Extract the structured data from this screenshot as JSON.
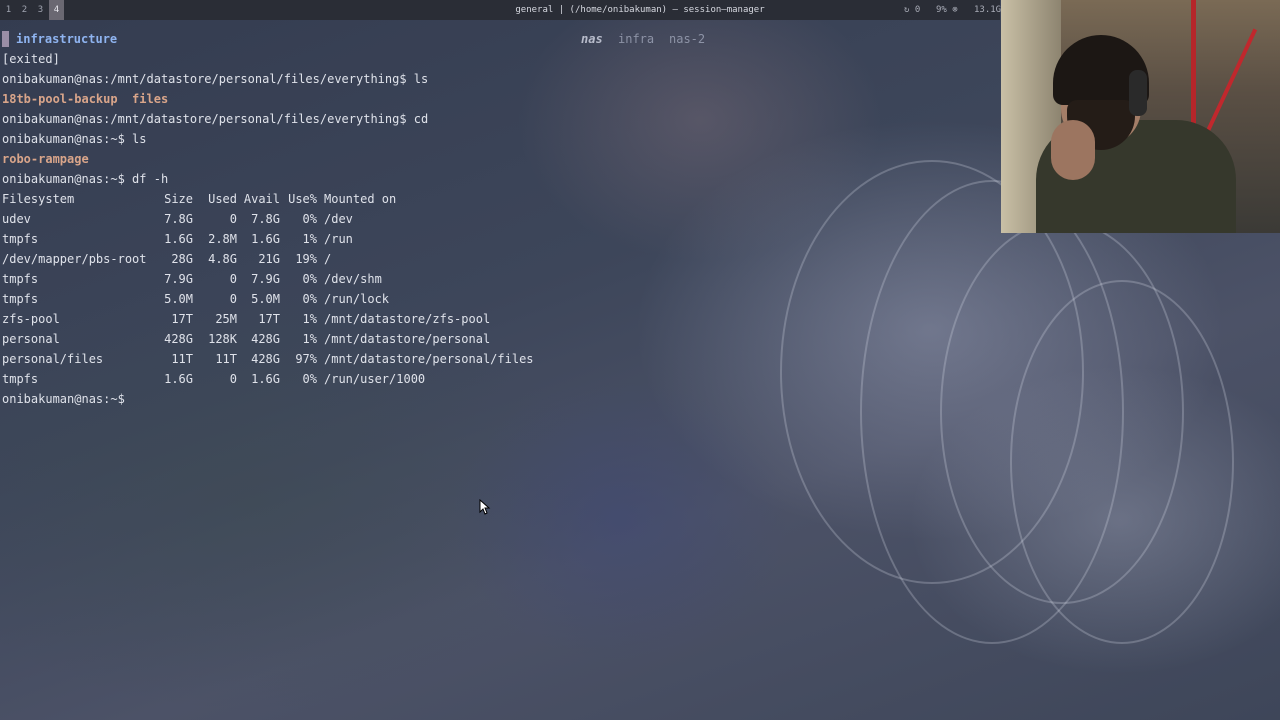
{
  "topbar": {
    "workspaces": [
      "1",
      "2",
      "3",
      "4"
    ],
    "active_workspace": "4",
    "window_title": "general | (/home/onibakuman) – session–manager",
    "stats": [
      "↻ 0",
      "9% ⊗",
      "13.1G"
    ]
  },
  "terminal": {
    "tab_name": "infrastructure",
    "sessions": [
      "nas",
      "infra",
      "nas-2"
    ],
    "current_session": "nas",
    "lines": [
      {
        "text": "[exited]",
        "type": "text"
      },
      {
        "text": "onibakuman@nas:/mnt/datastore/personal/files/everything$ ls",
        "type": "text"
      },
      {
        "dirs": [
          "18tb-pool-backup",
          "files"
        ],
        "type": "dirs"
      },
      {
        "text": "onibakuman@nas:/mnt/datastore/personal/files/everything$ cd",
        "type": "text"
      },
      {
        "text": "onibakuman@nas:~$ ls",
        "type": "text"
      },
      {
        "dirs": [
          "robo-rampage"
        ],
        "type": "dirs"
      },
      {
        "text": "onibakuman@nas:~$ df -h",
        "type": "text"
      }
    ],
    "df_table": {
      "columns": [
        "Filesystem",
        "Size",
        "Used",
        "Avail",
        "Use%",
        "Mounted on"
      ],
      "rows": [
        [
          "udev",
          "7.8G",
          "0",
          "7.8G",
          "0%",
          "/dev"
        ],
        [
          "tmpfs",
          "1.6G",
          "2.8M",
          "1.6G",
          "1%",
          "/run"
        ],
        [
          "/dev/mapper/pbs-root",
          "28G",
          "4.8G",
          "21G",
          "19%",
          "/"
        ],
        [
          "tmpfs",
          "7.9G",
          "0",
          "7.9G",
          "0%",
          "/dev/shm"
        ],
        [
          "tmpfs",
          "5.0M",
          "0",
          "5.0M",
          "0%",
          "/run/lock"
        ],
        [
          "zfs-pool",
          "17T",
          "25M",
          "17T",
          "1%",
          "/mnt/datastore/zfs-pool"
        ],
        [
          "personal",
          "428G",
          "128K",
          "428G",
          "1%",
          "/mnt/datastore/personal"
        ],
        [
          "personal/files",
          "11T",
          "11T",
          "428G",
          "97%",
          "/mnt/datastore/personal/files"
        ],
        [
          "tmpfs",
          "1.6G",
          "0",
          "1.6G",
          "0%",
          "/run/user/1000"
        ]
      ]
    },
    "final_prompt": "onibakuman@nas:~$"
  },
  "colors": {
    "tab_name": "#8fb4f0",
    "directory": "#d9a58a",
    "text": "#dfe2ea"
  },
  "webcam": {
    "label": "streamer webcam overlay"
  }
}
